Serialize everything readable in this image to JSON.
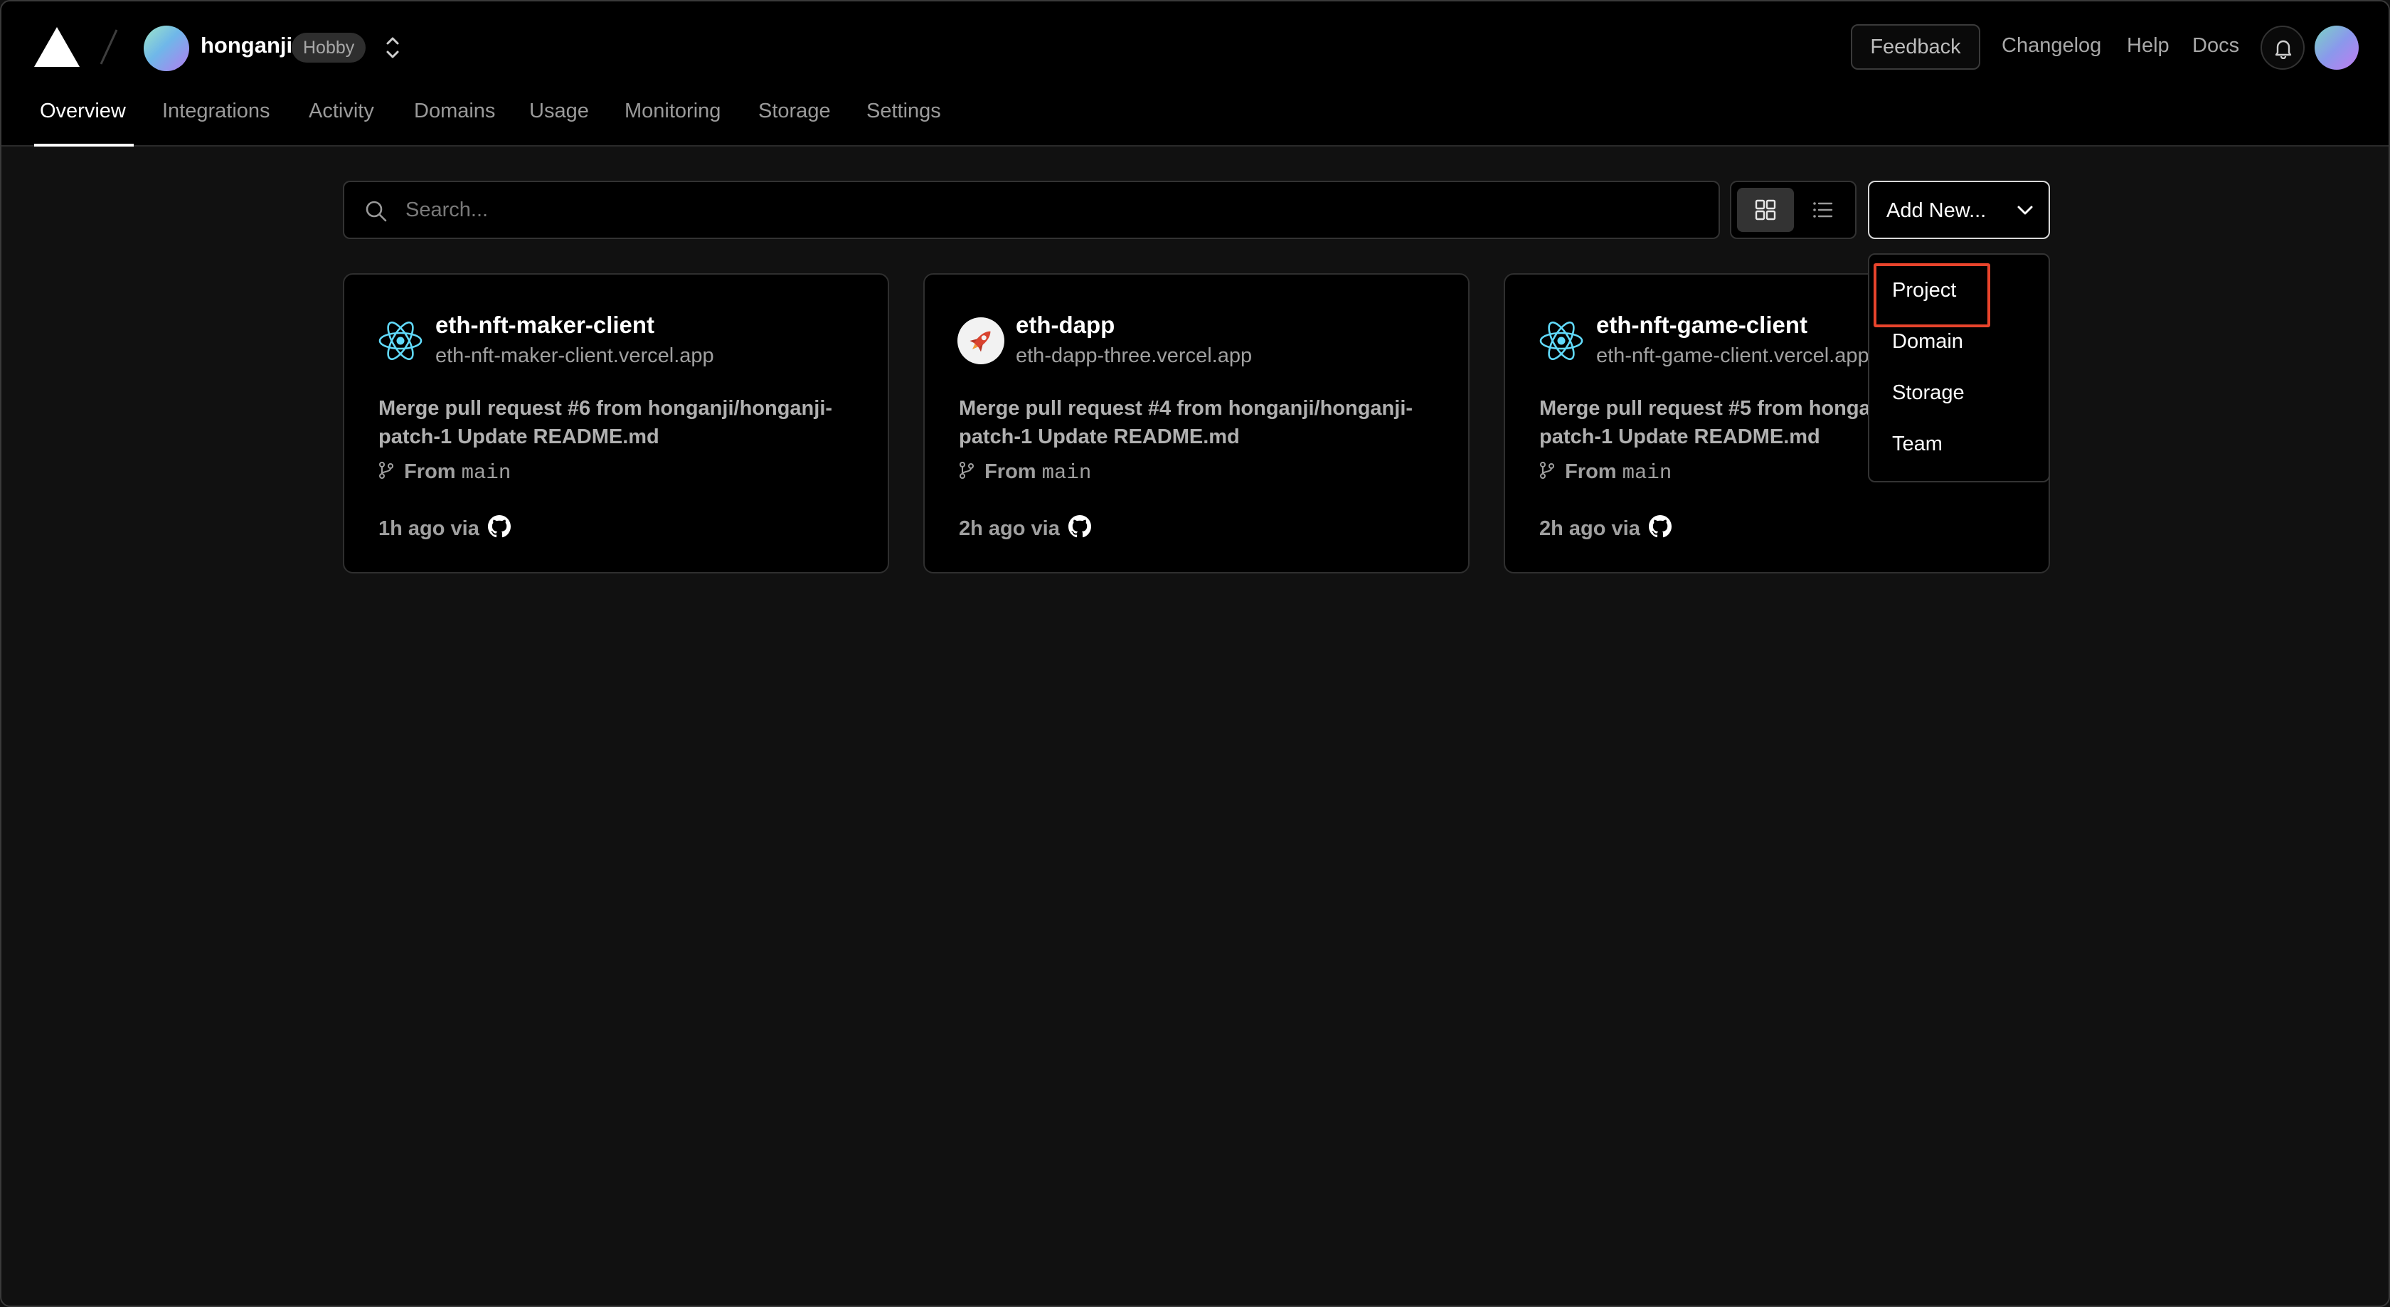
{
  "header": {
    "team_name": "honganji",
    "plan_badge": "Hobby",
    "feedback_label": "Feedback",
    "links": {
      "changelog": "Changelog",
      "help": "Help",
      "docs": "Docs"
    }
  },
  "tabs": {
    "overview": "Overview",
    "integrations": "Integrations",
    "activity": "Activity",
    "domains": "Domains",
    "usage": "Usage",
    "monitoring": "Monitoring",
    "storage": "Storage",
    "settings": "Settings",
    "active": "Overview"
  },
  "toolbar": {
    "search_placeholder": "Search...",
    "view_mode": "grid",
    "add_new_label": "Add New..."
  },
  "add_new_menu": {
    "items": [
      "Project",
      "Domain",
      "Storage",
      "Team"
    ],
    "highlighted": "Project"
  },
  "projects": [
    {
      "name": "eth-nft-maker-client",
      "url": "eth-nft-maker-client.vercel.app",
      "icon": "react-icon",
      "commit_message": "Merge pull request #6 from honganji/honganji-patch-1 Update README.md",
      "branch_prefix": "From",
      "branch": "main",
      "time": "1h ago via",
      "source_icon": "github-icon"
    },
    {
      "name": "eth-dapp",
      "url": "eth-dapp-three.vercel.app",
      "icon": "rocket-icon",
      "commit_message": "Merge pull request #4 from honganji/honganji-patch-1 Update README.md",
      "branch_prefix": "From",
      "branch": "main",
      "time": "2h ago via",
      "source_icon": "github-icon"
    },
    {
      "name": "eth-nft-game-client",
      "url": "eth-nft-game-client.vercel.app",
      "icon": "react-icon",
      "commit_message": "Merge pull request #5 from honganji/honganji-patch-1 Update README.md",
      "branch_prefix": "From",
      "branch": "main",
      "time": "2h ago via",
      "source_icon": "github-icon"
    }
  ],
  "colors": {
    "background": "#111111",
    "header_bg": "#000000",
    "highlight_outline": "#e8442c",
    "react_blue": "#61dafb"
  }
}
